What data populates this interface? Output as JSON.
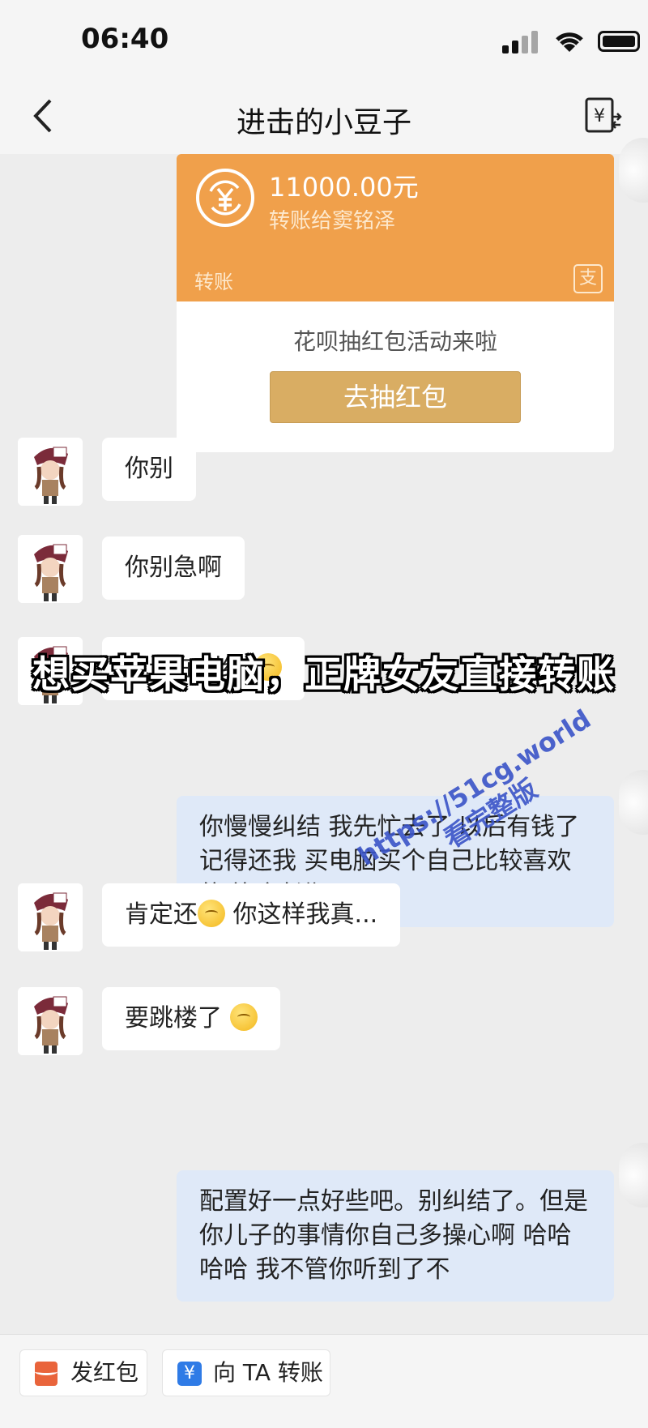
{
  "status_bar": {
    "time": "06:40"
  },
  "nav": {
    "title": "进击的小豆子",
    "transfer_icon": "yen-transfer-icon",
    "back_icon": "chevron-left-icon"
  },
  "transfer_card": {
    "amount": "11000.00元",
    "recipient": "转账给窦铭泽",
    "label": "转账",
    "brand_icon": "alipay-icon",
    "brand_glyph": "支",
    "promo_text": "花呗抽红包活动来啦",
    "promo_button": "去抽红包",
    "accent_color": "#f0a04b"
  },
  "messages": [
    {
      "side": "left",
      "text": "你别"
    },
    {
      "side": "left",
      "text": "你别急啊"
    },
    {
      "side": "left",
      "text": "我还在纠结",
      "emoji": "crying-face"
    },
    {
      "side": "right",
      "text": "你慢慢纠结 我先忙去了 以后有钱了记得还我 买电脑买个自己比较喜欢的 毕竟长期用"
    },
    {
      "side": "left",
      "text_before": "肯定还",
      "emoji": "crying-face",
      "text_after": " 你这样我真..."
    },
    {
      "side": "left",
      "text": "要跳楼了",
      "emoji": "crying-face"
    },
    {
      "side": "right",
      "text": "配置好一点好些吧。别纠结了。但是你儿子的事情你自己多操心啊 哈哈哈哈 我不管你听到了不"
    }
  ],
  "overlay": {
    "caption": "想买苹果电脑，正牌女友直接转账",
    "watermark_line1": "https://51cg.world",
    "watermark_line2": "看完整版"
  },
  "bottom_bar": {
    "red_packet_label": "发红包",
    "transfer_label": "向 TA 转账"
  },
  "colors": {
    "background": "#ededed",
    "right_bubble": "#dfe9f8",
    "promo_button": "#d9ad63"
  }
}
